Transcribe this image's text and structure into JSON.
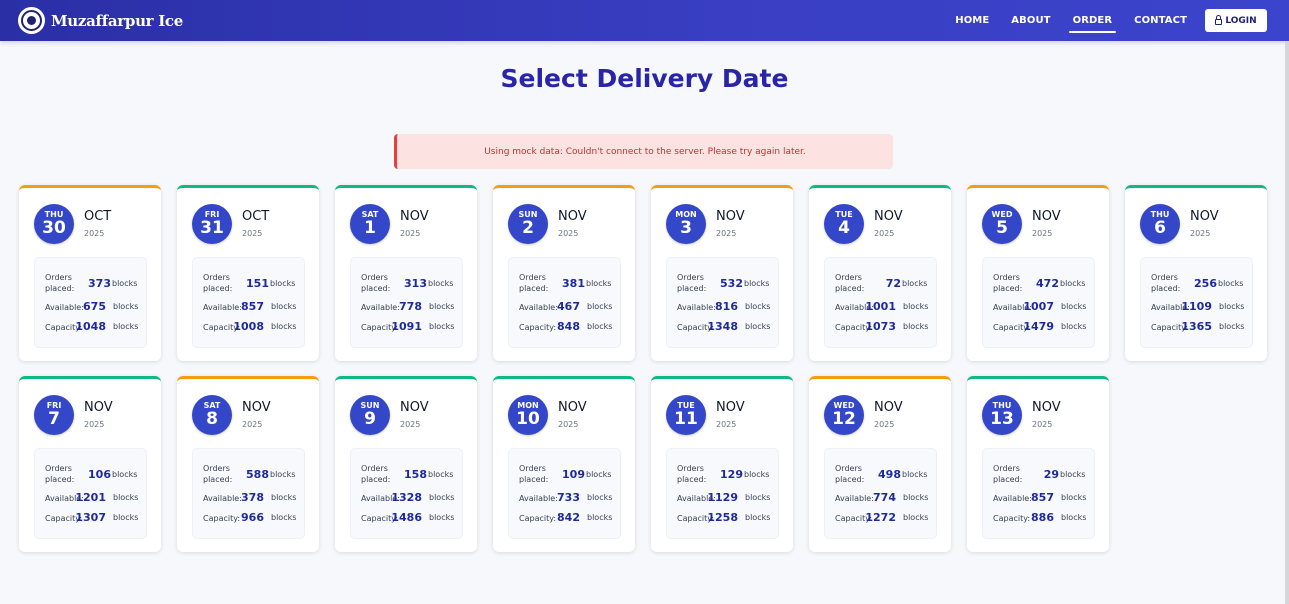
{
  "nav": {
    "brand": "Muzaffarpur Ice",
    "links": [
      "HOME",
      "ABOUT",
      "ORDER",
      "CONTACT"
    ],
    "login": "LOGIN"
  },
  "page": {
    "title": "Select Delivery Date",
    "alert": "Using mock data: Couldn't connect to the server. Please try again later."
  },
  "labels": {
    "orders_line1": "Orders",
    "orders_line2": "placed:",
    "available": "Available:",
    "capacity": "Capacity:",
    "unit": "blocks"
  },
  "colors": {
    "accent_orange": "#f59e0b",
    "accent_green": "#10b981",
    "circle": "#3447c9",
    "title": "#2a24a8"
  },
  "dates": [
    {
      "day": "THU",
      "date": "30",
      "month": "OCT",
      "year": "2025",
      "orders": "373",
      "available": "675",
      "capacity": "1048",
      "accent": "orange"
    },
    {
      "day": "FRI",
      "date": "31",
      "month": "OCT",
      "year": "2025",
      "orders": "151",
      "available": "857",
      "capacity": "1008",
      "accent": "green"
    },
    {
      "day": "SAT",
      "date": "1",
      "month": "NOV",
      "year": "2025",
      "orders": "313",
      "available": "778",
      "capacity": "1091",
      "accent": "green"
    },
    {
      "day": "SUN",
      "date": "2",
      "month": "NOV",
      "year": "2025",
      "orders": "381",
      "available": "467",
      "capacity": "848",
      "accent": "orange"
    },
    {
      "day": "MON",
      "date": "3",
      "month": "NOV",
      "year": "2025",
      "orders": "532",
      "available": "816",
      "capacity": "1348",
      "accent": "orange"
    },
    {
      "day": "TUE",
      "date": "4",
      "month": "NOV",
      "year": "2025",
      "orders": "72",
      "available": "1001",
      "capacity": "1073",
      "accent": "green"
    },
    {
      "day": "WED",
      "date": "5",
      "month": "NOV",
      "year": "2025",
      "orders": "472",
      "available": "1007",
      "capacity": "1479",
      "accent": "orange"
    },
    {
      "day": "THU",
      "date": "6",
      "month": "NOV",
      "year": "2025",
      "orders": "256",
      "available": "1109",
      "capacity": "1365",
      "accent": "green"
    },
    {
      "day": "FRI",
      "date": "7",
      "month": "NOV",
      "year": "2025",
      "orders": "106",
      "available": "1201",
      "capacity": "1307",
      "accent": "green"
    },
    {
      "day": "SAT",
      "date": "8",
      "month": "NOV",
      "year": "2025",
      "orders": "588",
      "available": "378",
      "capacity": "966",
      "accent": "orange"
    },
    {
      "day": "SUN",
      "date": "9",
      "month": "NOV",
      "year": "2025",
      "orders": "158",
      "available": "1328",
      "capacity": "1486",
      "accent": "green"
    },
    {
      "day": "MON",
      "date": "10",
      "month": "NOV",
      "year": "2025",
      "orders": "109",
      "available": "733",
      "capacity": "842",
      "accent": "green"
    },
    {
      "day": "TUE",
      "date": "11",
      "month": "NOV",
      "year": "2025",
      "orders": "129",
      "available": "1129",
      "capacity": "1258",
      "accent": "green"
    },
    {
      "day": "WED",
      "date": "12",
      "month": "NOV",
      "year": "2025",
      "orders": "498",
      "available": "774",
      "capacity": "1272",
      "accent": "orange"
    },
    {
      "day": "THU",
      "date": "13",
      "month": "NOV",
      "year": "2025",
      "orders": "29",
      "available": "857",
      "capacity": "886",
      "accent": "green"
    }
  ]
}
